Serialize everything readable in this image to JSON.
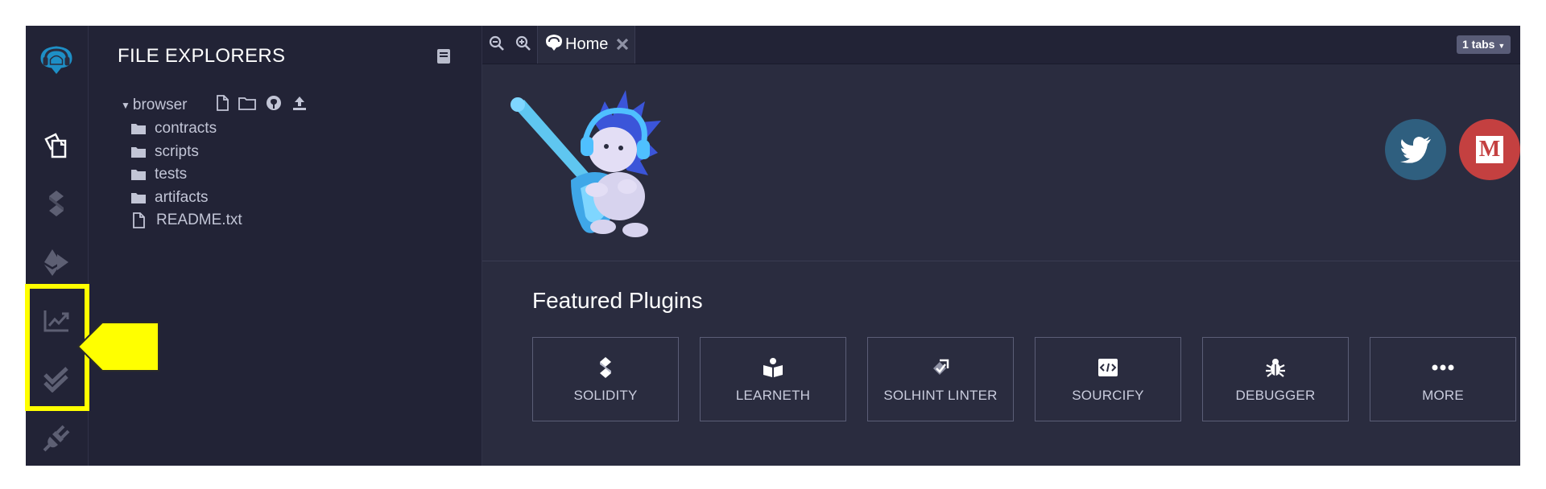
{
  "icon_panel": {
    "icons": [
      "remix-logo-icon",
      "file-explorer-icon",
      "solidity-compiler-icon",
      "deploy-run-icon",
      "analytics-icon",
      "unit-testing-icon",
      "plugin-manager-icon"
    ]
  },
  "file_explorer": {
    "title": "FILE EXPLORERS",
    "workspace": "browser",
    "items": [
      {
        "type": "folder",
        "name": "contracts"
      },
      {
        "type": "folder",
        "name": "scripts"
      },
      {
        "type": "folder",
        "name": "tests"
      },
      {
        "type": "folder",
        "name": "artifacts"
      },
      {
        "type": "file",
        "name": "README.txt"
      }
    ]
  },
  "tabs": {
    "active": "Home",
    "count_label": "1 tabs"
  },
  "home": {
    "featured_title": "Featured Plugins",
    "plugins": [
      {
        "label": "SOLIDITY",
        "icon": "solidity-icon"
      },
      {
        "label": "LEARNETH",
        "icon": "learneth-icon"
      },
      {
        "label": "SOLHINT LINTER",
        "icon": "solhint-icon"
      },
      {
        "label": "SOURCIFY",
        "icon": "sourcify-icon"
      },
      {
        "label": "DEBUGGER",
        "icon": "debugger-icon"
      },
      {
        "label": "MORE",
        "icon": "more-icon"
      }
    ],
    "social": [
      {
        "name": "twitter",
        "color": "#2f5f7f"
      },
      {
        "name": "medium",
        "color": "#c44040",
        "letter": "M"
      }
    ]
  },
  "annotation": {
    "highlight_color": "#ffff00"
  }
}
